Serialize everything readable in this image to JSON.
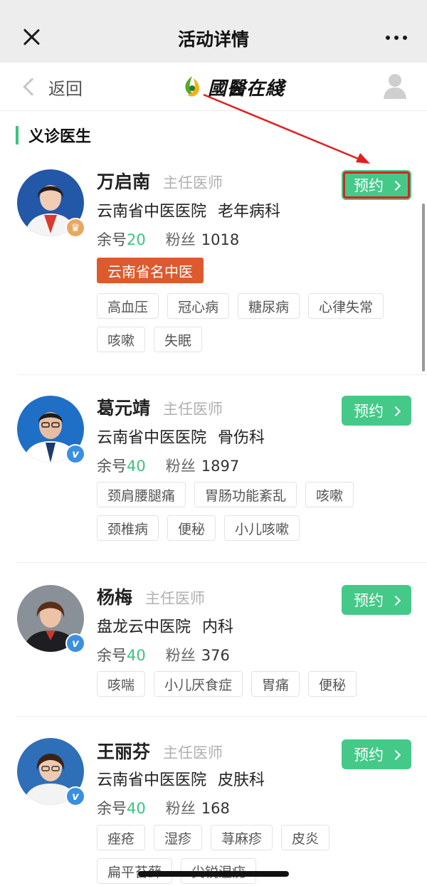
{
  "wechat": {
    "title": "活动详情"
  },
  "site": {
    "back_label": "返回",
    "logo_text": "國醫在綫"
  },
  "section": {
    "title": "义诊医生"
  },
  "book_label": "预约",
  "remaining_label": "余号",
  "fans_label": "粉丝",
  "colors": {
    "accent": "#44c988",
    "honor": "#dd5a2e",
    "verified": "#3b8fe0",
    "annotation": "#e02020"
  },
  "doctors": [
    {
      "name": "万启南",
      "title": "主任医师",
      "hospital": "云南省中医医院",
      "department": "老年病科",
      "remaining": "20",
      "fans": "1018",
      "honor": "云南省名中医",
      "badge": "crown-icon",
      "tags": [
        "高血压",
        "冠心病",
        "糖尿病",
        "心律失常",
        "咳嗽",
        "失眠"
      ]
    },
    {
      "name": "葛元靖",
      "title": "主任医师",
      "hospital": "云南省中医医院",
      "department": "骨伤科",
      "remaining": "40",
      "fans": "1897",
      "badge": "verified-icon",
      "tags": [
        "颈肩腰腿痛",
        "胃肠功能紊乱",
        "咳嗽",
        "颈椎病",
        "便秘",
        "小儿咳嗽"
      ]
    },
    {
      "name": "杨梅",
      "title": "主任医师",
      "hospital": "盘龙云中医院",
      "department": "内科",
      "remaining": "40",
      "fans": "376",
      "badge": "verified-icon",
      "tags": [
        "咳喘",
        "小儿厌食症",
        "胃痛",
        "便秘"
      ]
    },
    {
      "name": "王丽芬",
      "title": "主任医师",
      "hospital": "云南省中医医院",
      "department": "皮肤科",
      "remaining": "40",
      "fans": "168",
      "badge": "verified-icon",
      "tags": [
        "痤疮",
        "湿疹",
        "荨麻疹",
        "皮炎",
        "扁平苔藓",
        "尖锐湿疣"
      ]
    }
  ]
}
